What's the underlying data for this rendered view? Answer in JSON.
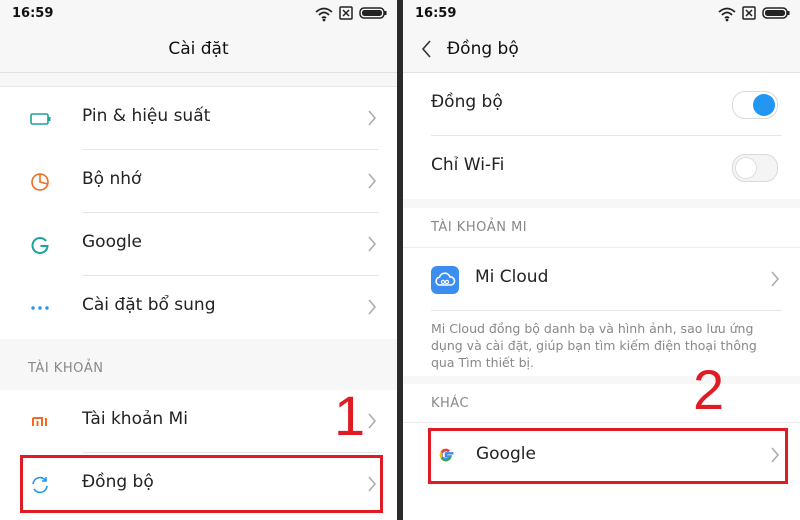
{
  "left": {
    "status_time": "16:59",
    "title": "Cài đặt",
    "rows": [
      {
        "label": "Pin & hiệu suất",
        "icon": "battery-icon"
      },
      {
        "label": "Bộ nhớ",
        "icon": "storage-pie-icon"
      },
      {
        "label": "Google",
        "icon": "google-g-icon"
      },
      {
        "label": "Cài đặt bổ sung",
        "icon": "more-dots-icon"
      }
    ],
    "section_account": "TÀI KHOẢN",
    "account_rows": [
      {
        "label": "Tài khoản Mi",
        "icon": "mi-logo-icon"
      },
      {
        "label": "Đồng bộ",
        "icon": "sync-icon"
      }
    ],
    "annotation_number": "1"
  },
  "right": {
    "status_time": "16:59",
    "title": "Đồng bộ",
    "toggles": [
      {
        "label": "Đồng bộ",
        "state": "on"
      },
      {
        "label": "Chỉ Wi-Fi",
        "state": "off"
      }
    ],
    "section_mi": "TÀI KHOẢN MI",
    "mi_cloud_label": "Mi Cloud",
    "mi_cloud_desc": "Mi Cloud đồng bộ danh bạ và hình ảnh, sao lưu ứng dụng và cài đặt, giúp bạn tìm kiếm điện thoại thông qua Tìm thiết bị.",
    "section_other": "KHÁC",
    "google_label": "Google",
    "annotation_number": "2"
  },
  "colors": {
    "accent": "#2196f3",
    "annotation": "#e01b24",
    "mi_orange": "#f26b22",
    "teal": "#1aa39a"
  }
}
